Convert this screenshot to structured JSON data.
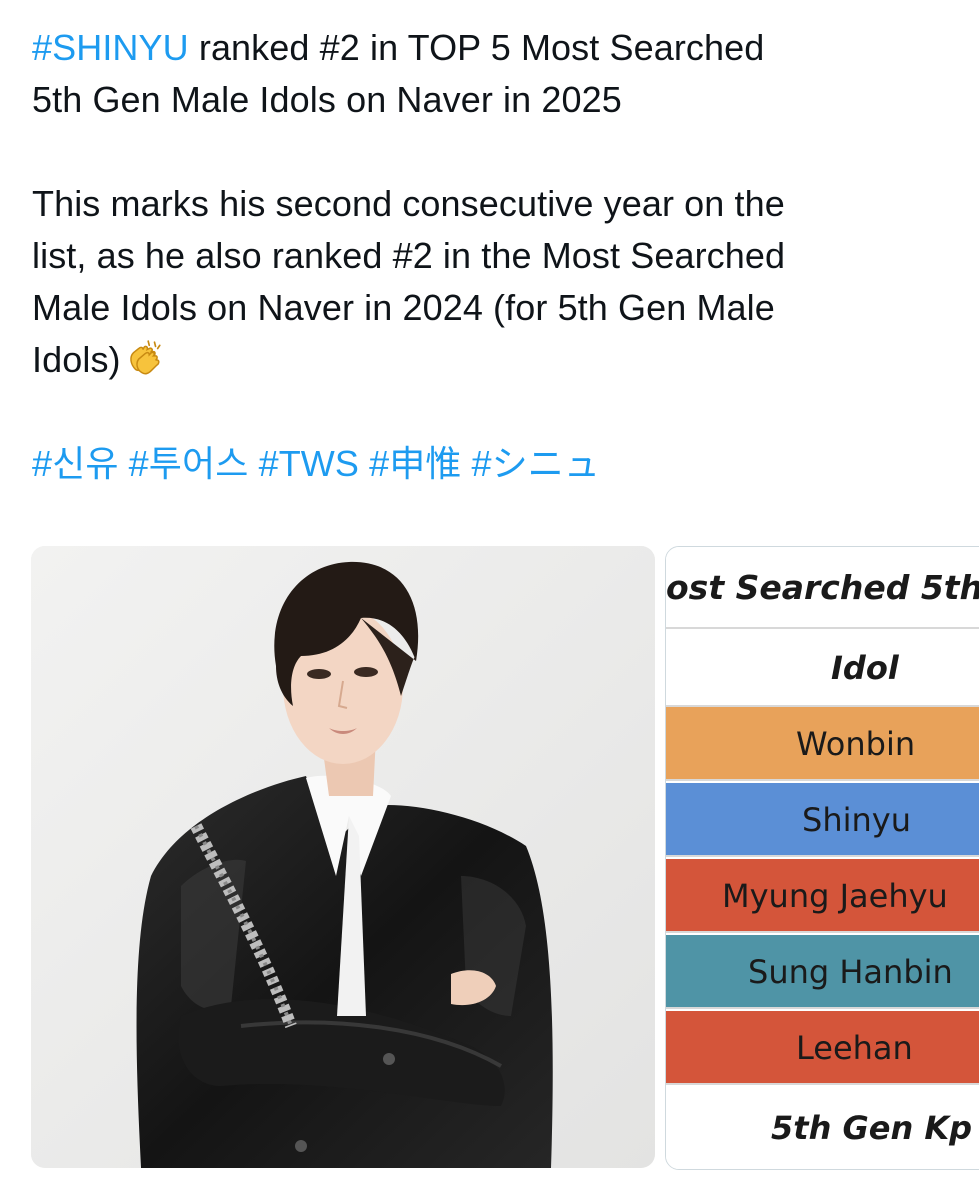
{
  "tweet": {
    "lines": [
      {
        "hashtag": "#SHINYU",
        "text": " ranked #2 in TOP 5 Most Searched"
      },
      {
        "text": "5th Gen Male Idols on Naver in 2025"
      },
      {
        "text": "This marks his second consecutive year on the"
      },
      {
        "text": "list, as he also ranked #2 in the Most Searched"
      },
      {
        "text": "Male Idols on Naver in 2024 (for 5th Gen Male"
      },
      {
        "text": "Idols)",
        "emoji": "clapping-hands-emoji"
      }
    ],
    "hashtags": [
      "#신유",
      "#투어스",
      "#TWS",
      "#申惟",
      "#シニュ"
    ]
  },
  "media": {
    "photo": {
      "subject": "person-in-black-leather-jacket"
    },
    "table": {
      "title": "ost Searched 5th",
      "header": "Idol",
      "rows": [
        {
          "name": "Wonbin",
          "color": "#e8a25a"
        },
        {
          "name": "Shinyu",
          "color": "#5b8fd6"
        },
        {
          "name": "Myung Jaehyu",
          "color": "#d4553a"
        },
        {
          "name": "Sung Hanbin",
          "color": "#4f94a6"
        },
        {
          "name": "Leehan",
          "color": "#d4553a"
        }
      ],
      "footer": "5th Gen Kp"
    }
  }
}
